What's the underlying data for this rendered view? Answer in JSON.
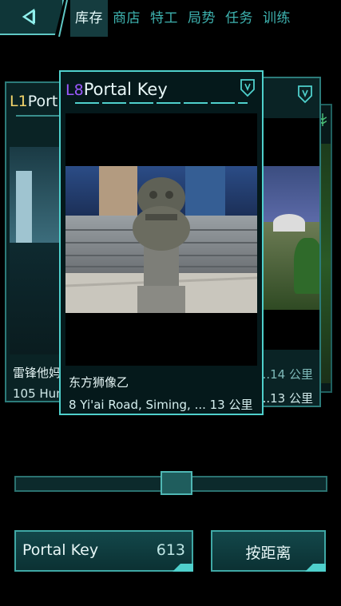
{
  "header": {
    "tabs": [
      {
        "label": "库存",
        "active": true
      },
      {
        "label": "商店",
        "active": false
      },
      {
        "label": "特工",
        "active": false
      },
      {
        "label": "局势",
        "active": false
      },
      {
        "label": "任务",
        "active": false
      },
      {
        "label": "训练",
        "active": false
      }
    ]
  },
  "cards": {
    "main": {
      "level": "L8",
      "title": "Portal Key",
      "portal_name": "东方狮像乙",
      "address": "8 Yi'ai Road, Siming, ... 13 公里",
      "level_color": "#9b59ff"
    },
    "left": {
      "level": "L1",
      "title": "Port",
      "portal_name": "雷锋他妈",
      "address": "105 Hun",
      "level_color": "#f2d36a"
    },
    "right": {
      "distance_partial": "d,...14 公里",
      "distance": "...13 公里"
    }
  },
  "slider": {
    "position": 0.52
  },
  "footer": {
    "key_label": "Portal Key",
    "key_count": "613",
    "sort_label": "按距离"
  },
  "colors": {
    "accent": "#4fd0cc",
    "background": "#000000"
  }
}
